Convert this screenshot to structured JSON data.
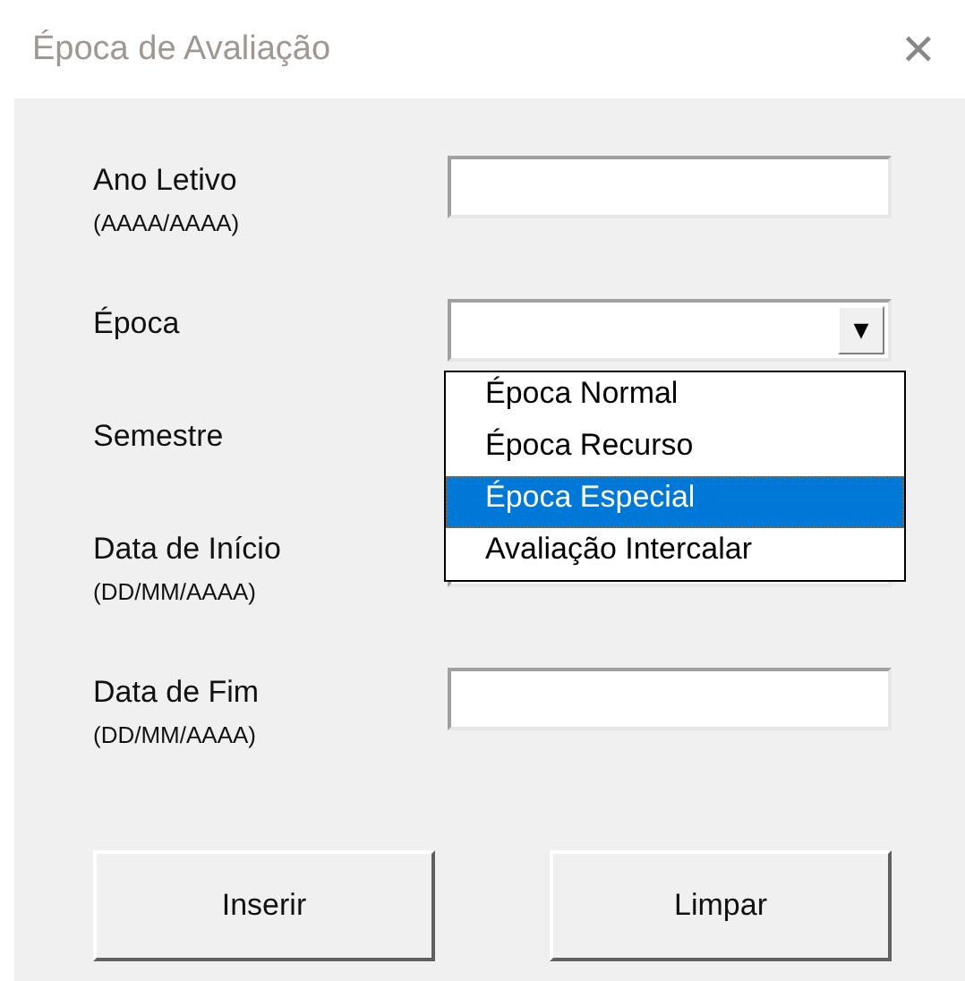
{
  "window": {
    "title": "Época de Avaliação",
    "close": "✕"
  },
  "fields": [
    {
      "label": "Ano Letivo",
      "hint": "(AAAA/AAAA)",
      "kind": "text"
    },
    {
      "label": "Época",
      "kind": "combo",
      "dropdown": {
        "arrow": "▼",
        "open": true,
        "options": [
          {
            "label": "Época Normal",
            "selected": false
          },
          {
            "label": "Época Recurso",
            "selected": false
          },
          {
            "label": "Época Especial",
            "selected": true
          },
          {
            "label": "Avaliação Intercalar",
            "selected": false
          }
        ]
      }
    },
    {
      "label": "Semestre",
      "kind": "covered"
    },
    {
      "label": "Data de Início",
      "hint": "(DD/MM/AAAA)",
      "kind": "text"
    },
    {
      "label": "Data de Fim",
      "hint": "(DD/MM/AAAA)",
      "kind": "text"
    }
  ],
  "buttons": [
    "Inserir",
    "Limpar"
  ]
}
